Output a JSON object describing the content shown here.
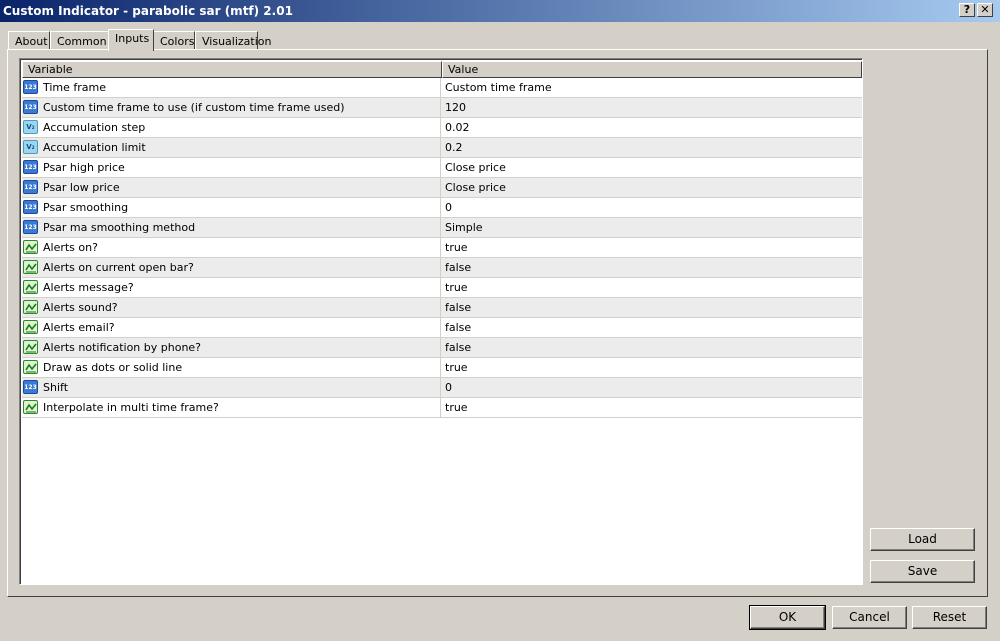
{
  "window": {
    "title": "Custom Indicator - parabolic sar (mtf) 2.01",
    "help_glyph": "?",
    "close_glyph": "✕"
  },
  "tabs": [
    {
      "label": "About",
      "active": false
    },
    {
      "label": "Common",
      "active": false
    },
    {
      "label": "Inputs",
      "active": true
    },
    {
      "label": "Colors",
      "active": false
    },
    {
      "label": "Visualization",
      "active": false
    }
  ],
  "grid": {
    "columns": [
      "Variable",
      "Value"
    ],
    "rows": [
      {
        "type": "int",
        "icon": "int-icon",
        "variable": "Time frame",
        "value": "Custom time frame"
      },
      {
        "type": "int",
        "icon": "int-icon",
        "variable": "Custom time frame to use (if custom time frame used)",
        "value": "120"
      },
      {
        "type": "dbl",
        "icon": "double-icon",
        "variable": "Accumulation step",
        "value": "0.02"
      },
      {
        "type": "dbl",
        "icon": "double-icon",
        "variable": "Accumulation limit",
        "value": "0.2"
      },
      {
        "type": "int",
        "icon": "int-icon",
        "variable": "Psar high price",
        "value": "Close price"
      },
      {
        "type": "int",
        "icon": "int-icon",
        "variable": "Psar low price",
        "value": "Close price"
      },
      {
        "type": "int",
        "icon": "int-icon",
        "variable": "Psar smoothing",
        "value": "0"
      },
      {
        "type": "int",
        "icon": "int-icon",
        "variable": "Psar ma smoothing method",
        "value": "Simple"
      },
      {
        "type": "bool",
        "icon": "bool-icon",
        "variable": "Alerts on?",
        "value": "true"
      },
      {
        "type": "bool",
        "icon": "bool-icon",
        "variable": "Alerts on current open bar?",
        "value": "false"
      },
      {
        "type": "bool",
        "icon": "bool-icon",
        "variable": "Alerts message?",
        "value": "true"
      },
      {
        "type": "bool",
        "icon": "bool-icon",
        "variable": "Alerts sound?",
        "value": "false"
      },
      {
        "type": "bool",
        "icon": "bool-icon",
        "variable": "Alerts email?",
        "value": "false"
      },
      {
        "type": "bool",
        "icon": "bool-icon",
        "variable": "Alerts notification by phone?",
        "value": "false"
      },
      {
        "type": "bool",
        "icon": "bool-icon",
        "variable": "Draw as dots or solid line",
        "value": "true"
      },
      {
        "type": "int",
        "icon": "int-icon",
        "variable": "Shift",
        "value": "0"
      },
      {
        "type": "bool",
        "icon": "bool-icon",
        "variable": "Interpolate in multi time frame?",
        "value": "true"
      }
    ]
  },
  "side_buttons": {
    "load": "Load",
    "save": "Save"
  },
  "footer_buttons": {
    "ok": "OK",
    "cancel": "Cancel",
    "reset": "Reset"
  },
  "colors": {
    "titlebar_start": "#0a246a",
    "titlebar_end": "#a6caf0",
    "dialog_bg": "#d4d0c8",
    "row_alt": "#ececec"
  }
}
